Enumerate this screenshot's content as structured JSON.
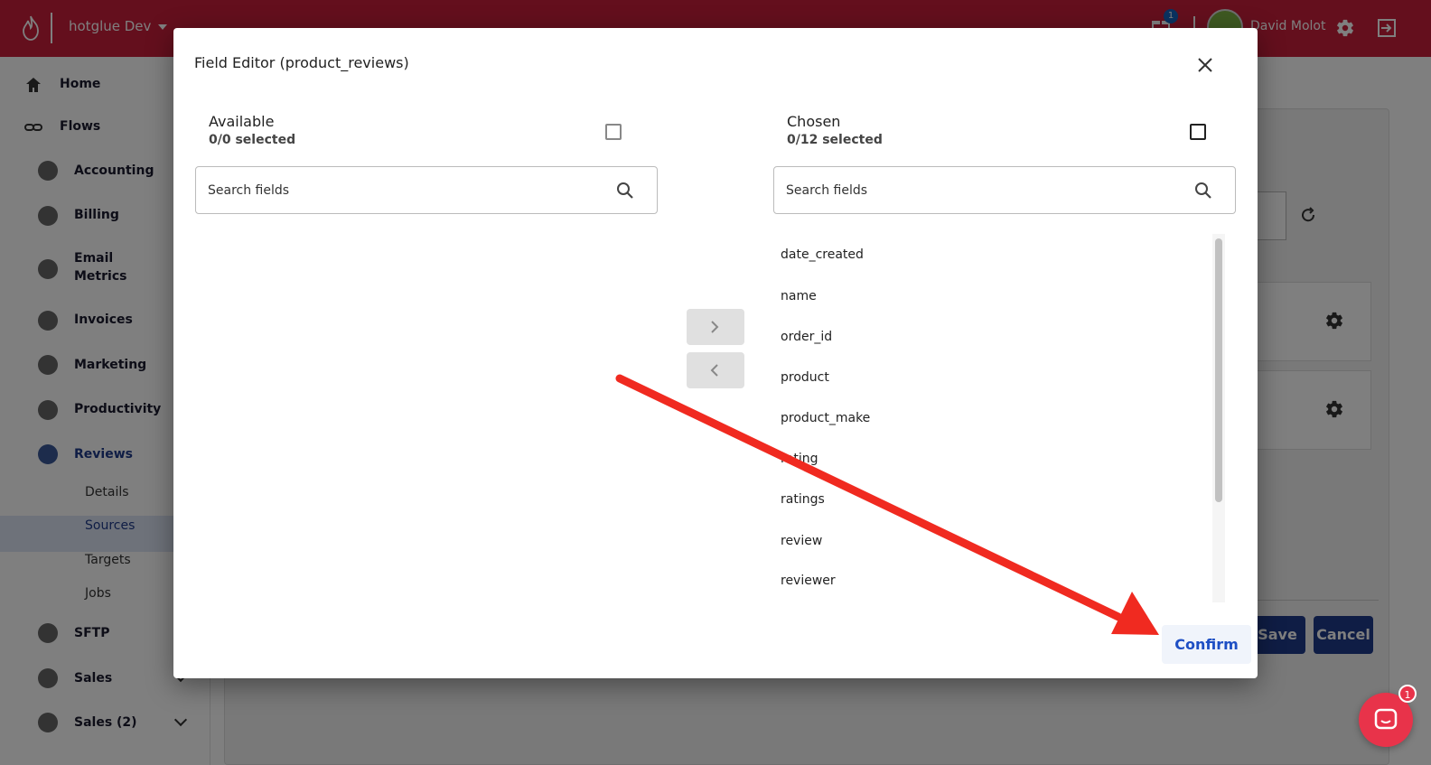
{
  "topbar": {
    "tenant": "hotglue Dev",
    "gift_badge": "1",
    "user_name": "David Molot"
  },
  "sidebar": {
    "items": [
      {
        "label": "Home"
      },
      {
        "label": "Flows"
      },
      {
        "label": "Accounting"
      },
      {
        "label": "Billing"
      },
      {
        "label": "Email Metrics"
      },
      {
        "label": "Invoices"
      },
      {
        "label": "Marketing"
      },
      {
        "label": "Productivity"
      },
      {
        "label": "Reviews"
      },
      {
        "label": "SFTP"
      },
      {
        "label": "Sales"
      },
      {
        "label": "Sales (2)"
      }
    ],
    "sub_items": [
      {
        "label": "Details"
      },
      {
        "label": "Sources"
      },
      {
        "label": "Targets"
      },
      {
        "label": "Jobs"
      }
    ]
  },
  "main": {
    "save_label": "Save",
    "cancel_label": "Cancel"
  },
  "modal": {
    "title": "Field Editor (product_reviews)",
    "available": {
      "title": "Available",
      "count": "0/0 selected",
      "search_placeholder": "Search fields"
    },
    "chosen": {
      "title": "Chosen",
      "count": "0/12 selected",
      "search_placeholder": "Search fields",
      "fields": [
        "date_created",
        "name",
        "order_id",
        "product",
        "product_make",
        "rating",
        "ratings",
        "review",
        "reviewer"
      ]
    },
    "confirm_label": "Confirm"
  },
  "chat": {
    "badge": "1"
  },
  "colors": {
    "brand": "#c81e3a",
    "primary": "#1e3a8a",
    "confirm_text": "#1e4fc4",
    "arrow": "#f02a20"
  }
}
